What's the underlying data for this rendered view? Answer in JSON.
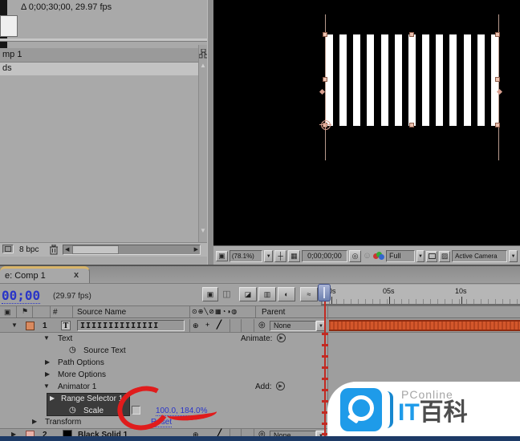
{
  "project_panel": {
    "info_text": "Δ 0;00;30;00, 29.97 fps",
    "rows": [
      {
        "label": "mp 1"
      },
      {
        "label": "ds"
      }
    ],
    "bpc_label": "8 bpc"
  },
  "viewer": {
    "stripes_count": 13,
    "toolbar": {
      "zoom_level": "(78.1%)",
      "timecode": "0;00;00;00",
      "resolution": "Full",
      "camera_view": "Active Camera"
    }
  },
  "timeline": {
    "tab_label": "e: Comp 1",
    "tab_close": "x",
    "current_time": "00;00",
    "fps_label": "(29.97 fps)",
    "columns": {
      "number": "#",
      "source_name": "Source Name",
      "parent": "Parent"
    },
    "ruler_labels": [
      "0s",
      "05s",
      "10s"
    ],
    "layer1": {
      "number": "1",
      "type_badge": "T",
      "name": "IIIIIIIIIIIIII",
      "parent_value": "None"
    },
    "layer2": {
      "number": "2",
      "name": "Black Solid 1",
      "parent_value": "None"
    },
    "props": {
      "text": "Text",
      "animate_label": "Animate:",
      "source_text": "Source Text",
      "path_options": "Path Options",
      "more_options": "More Options",
      "animator": "Animator 1",
      "add_label": "Add:",
      "range_selector": "Range Selector 1",
      "scale_label": "Scale",
      "scale_value": "100.0, 184.0%",
      "transform": "Transform",
      "reset_label": "Reset"
    }
  },
  "watermark": {
    "brand": "PConline",
    "logo_it": "IT",
    "logo_cn": "百科"
  },
  "icons": {
    "tri_open": "▼",
    "tri_closed": "▶",
    "tri_up": "▲",
    "tri_down": "▼",
    "stopwatch": "◷",
    "pickwhip": "◎",
    "dropdown": "▼",
    "left_arrow": "◀",
    "right_arrow": "▶",
    "play": "▶",
    "av_header": "▣",
    "label_header": "⚑",
    "switches_header": [
      "⊙",
      "⊕",
      "╲",
      "⊘",
      "▦",
      "◔",
      "◑",
      "◍"
    ],
    "switch_a": "⊕",
    "switch_b": "+",
    "switch_quality": "╱",
    "live_update": "▣",
    "comp_mini": "◫",
    "draft_3d": "◪",
    "frame_blend": "▥",
    "motion_blur": "◐",
    "graph_editor": "≈",
    "panel_menu": "▣",
    "safe_zones": "┼",
    "grid": "▦",
    "snapshot": "◎",
    "ghost": "☺",
    "trans_grid": "▨"
  },
  "colors": {
    "layer_bar_orange": "#d4572b",
    "cti_red": "#cc2222",
    "link_blue": "#2a35c8",
    "watermark_blue": "#1e9be9",
    "label1": "#d98a5f",
    "label2": "#e8b2a8"
  }
}
